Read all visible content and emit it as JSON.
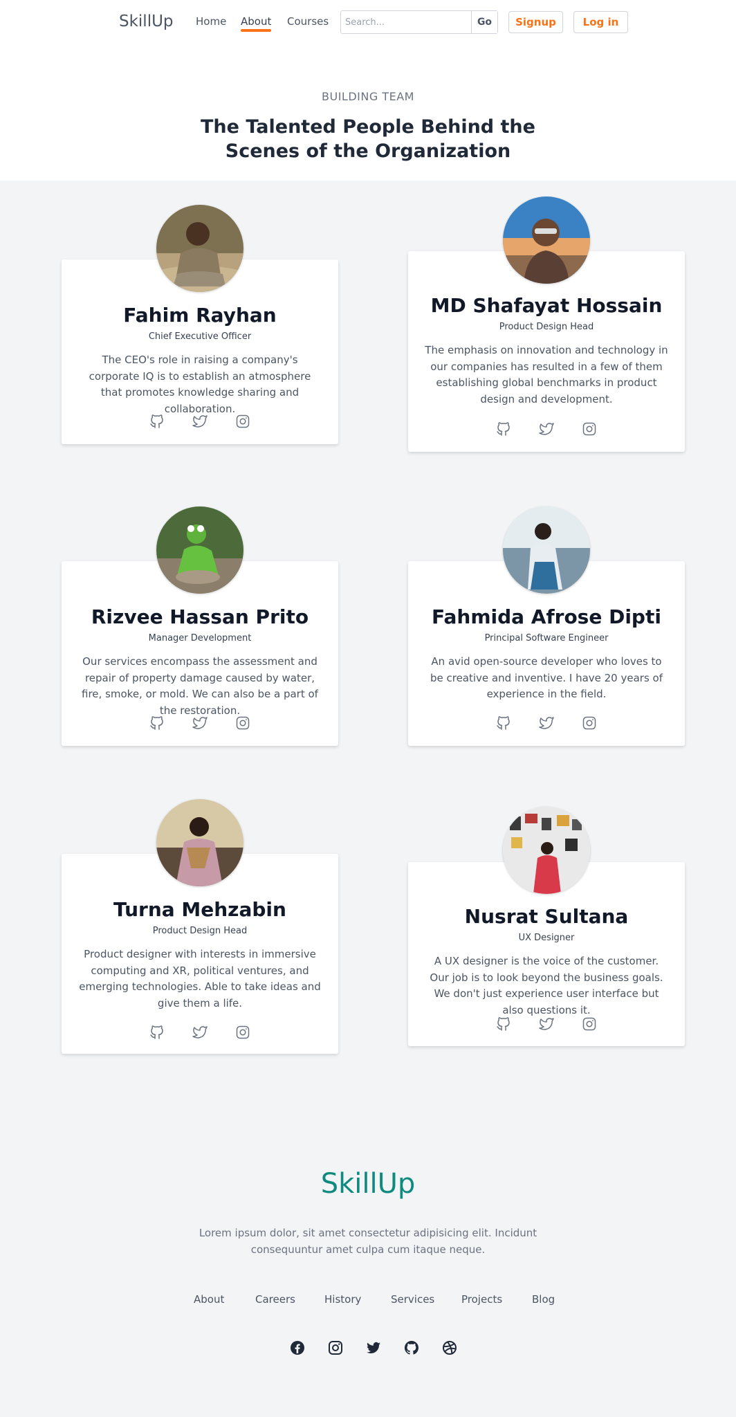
{
  "nav": {
    "brand": "SkillUp",
    "links": [
      "Home",
      "About",
      "Courses"
    ],
    "active_link": "About",
    "search": {
      "placeholder": "Search...",
      "value": "",
      "button": "Go"
    },
    "signup": "Signup",
    "login": "Log in",
    "accent_color": "#f97316"
  },
  "hero": {
    "eyebrow": "BUILDING TEAM",
    "title": "The Talented People Behind the Scenes of the Organization"
  },
  "team": [
    {
      "name": "Fahim Rayhan",
      "role": "Chief Executive Officer",
      "bio": "The CEO's role in raising a company's corporate IQ is to establish an atmosphere that promotes knowledge sharing and collaboration.",
      "photo": "photo-child-sitting"
    },
    {
      "name": "MD Shafayat Hossain",
      "role": "Product Design Head",
      "bio": "The emphasis on innovation and technology in our companies has resulted in a few of them establishing global benchmarks in product design and development.",
      "photo": "photo-woman-sunglasses-beach"
    },
    {
      "name": "Rizvee Hassan Prito",
      "role": "Manager Development",
      "bio": "Our services encompass the assessment and repair of property damage caused by water, fire, smoke, or mold. We can also be a part of the restoration.",
      "photo": "photo-green-frog-puppet"
    },
    {
      "name": "Fahmida Afrose Dipti",
      "role": "Principal Software Engineer",
      "bio": "An avid open-source developer who loves to be creative and inventive. I have 20 years of experience in the field.",
      "photo": "photo-woman-by-lake"
    },
    {
      "name": "Turna Mehzabin",
      "role": "Product Design Head",
      "bio": "Product designer with interests in immersive computing and XR, political ventures, and emerging technologies. Able to take ideas and give them a life.",
      "photo": "photo-woman-pink-saree"
    },
    {
      "name": "Nusrat Sultana",
      "role": "UX Designer",
      "bio": "A UX designer is the voice of the customer. Our job is to look beyond the business goals. We don't just experience user interface but also questions it.",
      "photo": "photo-woman-gallery-wall"
    }
  ],
  "card_socials": [
    "github-icon",
    "twitter-icon",
    "instagram-icon"
  ],
  "footer": {
    "brand": "SkillUp",
    "brand_color": "#0f8a7e",
    "text": "Lorem ipsum dolor, sit amet consectetur adipisicing elit. Incidunt consequuntur amet culpa cum itaque neque.",
    "links": [
      "About",
      "Careers",
      "History",
      "Services",
      "Projects",
      "Blog"
    ],
    "socials": [
      "facebook-icon",
      "instagram-icon",
      "twitter-icon",
      "github-icon",
      "dribbble-icon"
    ]
  }
}
